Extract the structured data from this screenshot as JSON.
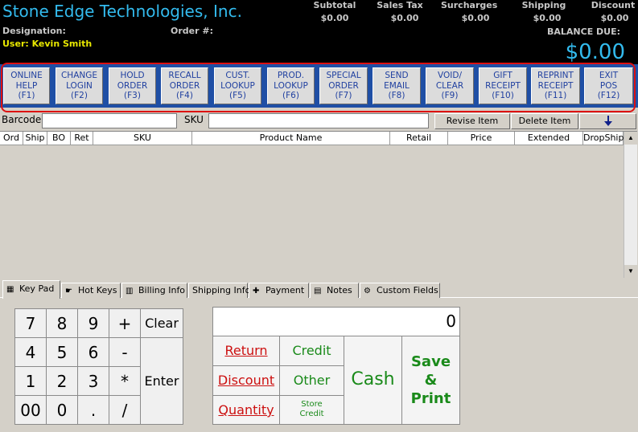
{
  "header": {
    "company": "Stone Edge Technologies, Inc.",
    "designation_label": "Designation:",
    "order_label": "Order #:",
    "user": "User: Kevin Smith",
    "totals": [
      {
        "label": "Subtotal",
        "value": "$0.00"
      },
      {
        "label": "Sales Tax",
        "value": "$0.00"
      },
      {
        "label": "Surcharges",
        "value": "$0.00"
      },
      {
        "label": "Shipping",
        "value": "$0.00"
      },
      {
        "label": "Discount",
        "value": "$0.00"
      }
    ],
    "balance_label": "BALANCE DUE:",
    "balance_value": "$0.00"
  },
  "function_keys": [
    {
      "label": "ONLINE\nHELP\n(F1)"
    },
    {
      "label": "CHANGE\nLOGIN\n(F2)"
    },
    {
      "label": "HOLD\nORDER\n(F3)"
    },
    {
      "label": "RECALL\nORDER\n(F4)"
    },
    {
      "label": "CUST.\nLOOKUP\n(F5)"
    },
    {
      "label": "PROD.\nLOOKUP\n(F6)"
    },
    {
      "label": "SPECIAL\nORDER\n(F7)"
    },
    {
      "label": "SEND\nEMAIL\n(F8)"
    },
    {
      "label": "VOID/\nCLEAR\n(F9)"
    },
    {
      "label": "GIFT\nRECEIPT\n(F10)"
    },
    {
      "label": "REPRINT\nRECEIPT\n(F11)"
    },
    {
      "label": "EXIT\nPOS\n(F12)"
    }
  ],
  "inputs": {
    "barcode_label": "Barcode",
    "barcode_value": "",
    "sku_label": "SKU",
    "sku_value": "",
    "revise_label": "Revise Item",
    "delete_label": "Delete Item"
  },
  "grid": {
    "columns": [
      "Ord",
      "Ship",
      "BO",
      "Ret",
      "SKU",
      "Product Name",
      "Retail",
      "Price",
      "Extended",
      "DropShip"
    ]
  },
  "tabs": [
    {
      "label": "Key Pad",
      "icon": "keypad-icon"
    },
    {
      "label": "Hot Keys",
      "icon": "hand-pointer-icon"
    },
    {
      "label": "Billing Info",
      "icon": "book-icon"
    },
    {
      "label": "Shipping Info",
      "icon": ""
    },
    {
      "label": "Payment",
      "icon": "money-plus-icon"
    },
    {
      "label": "Notes",
      "icon": "notepad-icon"
    },
    {
      "label": "Custom Fields",
      "icon": "custom-fields-icon"
    }
  ],
  "keypad": {
    "keys": [
      "7",
      "8",
      "9",
      "+",
      "4",
      "5",
      "6",
      "-",
      "1",
      "2",
      "3",
      "*",
      "00",
      "0",
      ".",
      "/"
    ],
    "clear_label": "Clear",
    "enter_label": "Enter"
  },
  "payment": {
    "display_value": "0",
    "return_label": "Return",
    "discount_label": "Discount",
    "quantity_label": "Quantity",
    "credit_label": "Credit",
    "other_label": "Other",
    "store_credit_label": "Store\nCredit",
    "cash_label": "Cash",
    "save_print_label": "Save\n&\nPrint"
  },
  "colors": {
    "header_bg": "#000000",
    "accent_blue": "#33bbee",
    "user_yellow": "#e8e800",
    "fkey_bar": "#1f4fa5",
    "ring_red": "#dd1010",
    "text_red": "#cc1010",
    "text_green": "#1a8a1a"
  }
}
